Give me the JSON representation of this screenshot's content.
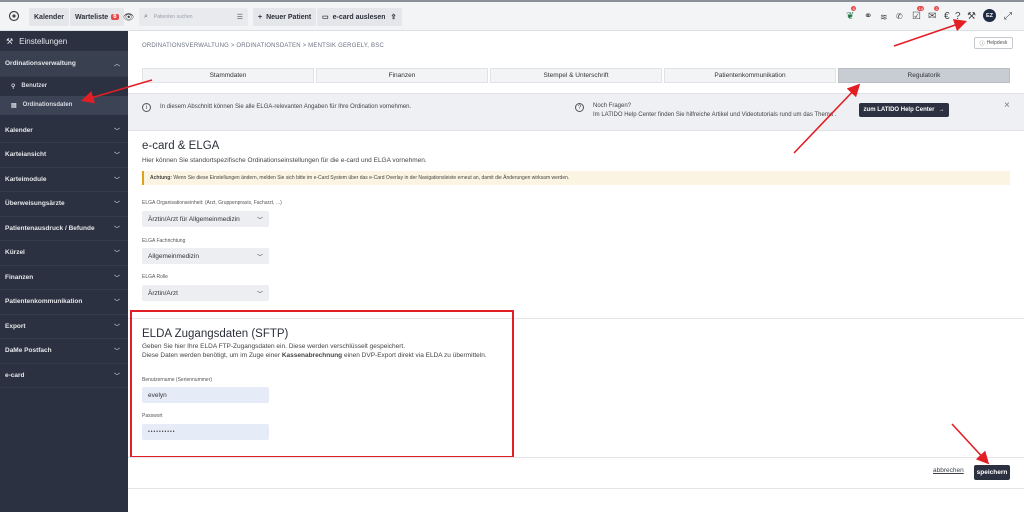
{
  "topbar": {
    "calendar_label": "Kalender",
    "waitlist_label": "Warteliste",
    "waitlist_badge": "6",
    "search_placeholder": "Patienten suchen",
    "new_patient_label": "Neuer Patient",
    "ecard_label": "e-card auslesen",
    "avatar_initials": "EZ",
    "notif_badge_1": "4",
    "notif_badge_2": "14",
    "notif_badge_3": "2"
  },
  "sidebar": {
    "header": "Einstellungen",
    "sections": [
      {
        "label": "Ordinationsverwaltung"
      },
      {
        "label": "Kalender"
      },
      {
        "label": "Karteiansicht"
      },
      {
        "label": "Karteimodule"
      },
      {
        "label": "Überweisungsärzte"
      },
      {
        "label": "Patientenausdruck / Befunde"
      },
      {
        "label": "Kürzel"
      },
      {
        "label": "Finanzen"
      },
      {
        "label": "Patientenkommunikation"
      },
      {
        "label": "Export"
      },
      {
        "label": "DaMe Postfach"
      },
      {
        "label": "e-card"
      }
    ],
    "sub_items": [
      {
        "label": "Benutzer"
      },
      {
        "label": "Ordinationsdaten"
      }
    ]
  },
  "breadcrumb": "ORDINATIONSVERWALTUNG > ORDINATIONSDATEN > MENTSIK GERGELY, BSC",
  "helpdesk_label": "Helpdesk",
  "tabs": [
    {
      "label": "Stammdaten"
    },
    {
      "label": "Finanzen"
    },
    {
      "label": "Stempel & Unterschrift"
    },
    {
      "label": "Patientenkommunikation"
    },
    {
      "label": "Regulatorik"
    }
  ],
  "info": {
    "text": "In diesem Abschnitt können Sie alle ELGA-relevanten Angaben für Ihre Ordination vornehmen.",
    "q_title": "Noch Fragen?",
    "q_text": "Im LATIDO Help Center finden Sie hilfreiche Artikel und Videotutorials rund um das Thema .",
    "help_center_label": "zum LATIDO Help Center"
  },
  "ecard_elga": {
    "title": "e-card & ELGA",
    "subtitle": "Hier können Sie standortspezifische Ordinationseinstellungen für die e-card und ELGA vornehmen.",
    "warning_bold": "Achtung:",
    "warning_text": " Wenn Sie diese Einstellungen ändern, melden Sie sich bitte im e-Card System über das e-Card Overlay in der Navigationsleiste erneut an, damit die Änderungen wirksam werden.",
    "org_label": "ELGA Organisationseinheit: (Arzt, Gruppenpraxis, Facharzt, ...)",
    "org_value": "Ärztin/Arzt für Allgemeinmedizin",
    "fach_label": "ELGA Fachrichtung",
    "fach_value": "Allgemeinmedizin",
    "rolle_label": "ELGA Rolle",
    "rolle_value": "Ärztin/Arzt"
  },
  "sftp": {
    "title": "ELDA Zugangsdaten (SFTP)",
    "line1": "Geben Sie hier Ihre ELDA FTP-Zugangsdaten ein. Diese werden verschlüsselt gespeichert.",
    "line2_pre": "Diese Daten werden benötigt, um im Zuge einer ",
    "line2_bold": "Kassenabrechnung",
    "line2_post": " einen DVP-Export direkt via ELDA zu übermitteln.",
    "user_label": "Benutzername (Seriennummer)",
    "user_value": "evelyn",
    "pass_label": "Passwort",
    "pass_value": "••••••••••"
  },
  "footer": {
    "cancel_label": "abbrechen",
    "save_label": "speichern"
  },
  "colors": {
    "sidebar_bg": "#2b3140",
    "accent_dark": "#2b3140",
    "annotation_red": "#e31f26",
    "warning_border": "#e0a21a"
  }
}
